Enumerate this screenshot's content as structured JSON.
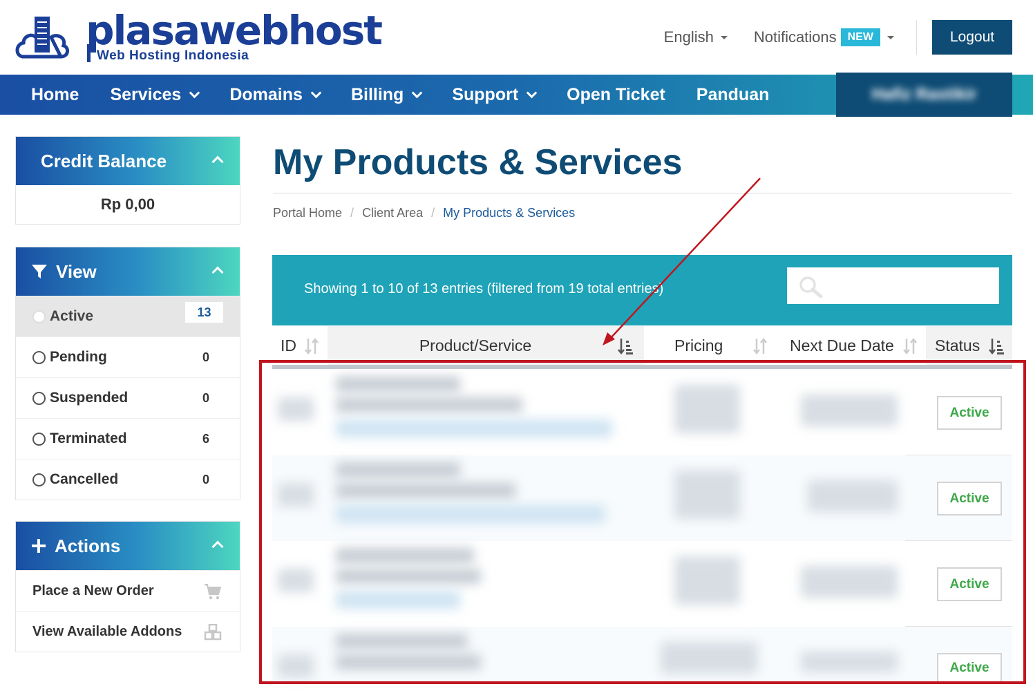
{
  "brand": {
    "name": "plasawebhost",
    "tagline": "Web Hosting Indonesia"
  },
  "topnav": {
    "language": "English",
    "notifications": "Notifications",
    "new_badge": "NEW",
    "logout": "Logout"
  },
  "mainnav": {
    "items": [
      "Home",
      "Services",
      "Domains",
      "Billing",
      "Support",
      "Open Ticket",
      "Panduan"
    ],
    "user_name": "Hafiz Rastikir"
  },
  "sidebar": {
    "credit": {
      "title": "Credit Balance",
      "amount": "Rp 0,00"
    },
    "view": {
      "title": "View",
      "filters": [
        {
          "label": "Active",
          "count": "13"
        },
        {
          "label": "Pending",
          "count": "0"
        },
        {
          "label": "Suspended",
          "count": "0"
        },
        {
          "label": "Terminated",
          "count": "6"
        },
        {
          "label": "Cancelled",
          "count": "0"
        }
      ]
    },
    "actions": {
      "title": "Actions",
      "items": [
        {
          "label": "Place a New Order",
          "icon": "cart-icon"
        },
        {
          "label": "View Available Addons",
          "icon": "cubes-icon"
        }
      ]
    }
  },
  "main": {
    "title": "My Products & Services",
    "breadcrumb": [
      "Portal Home",
      "Client Area",
      "My Products & Services"
    ],
    "table": {
      "showing": "Showing 1 to 10 of 13 entries (filtered from 19 total entries)",
      "columns": [
        "ID",
        "Product/Service",
        "Pricing",
        "Next Due Date",
        "Status"
      ],
      "rows": [
        {
          "status": "Active"
        },
        {
          "status": "Active"
        },
        {
          "status": "Active"
        },
        {
          "status": "Active"
        }
      ]
    }
  },
  "colors": {
    "brand_dark": "#0f4c75",
    "nav_start": "#1a4fa3",
    "nav_end": "#20a7b4",
    "table_bar": "#1ea3b8",
    "status_active": "#3da848",
    "annotation": "#c0151e"
  }
}
